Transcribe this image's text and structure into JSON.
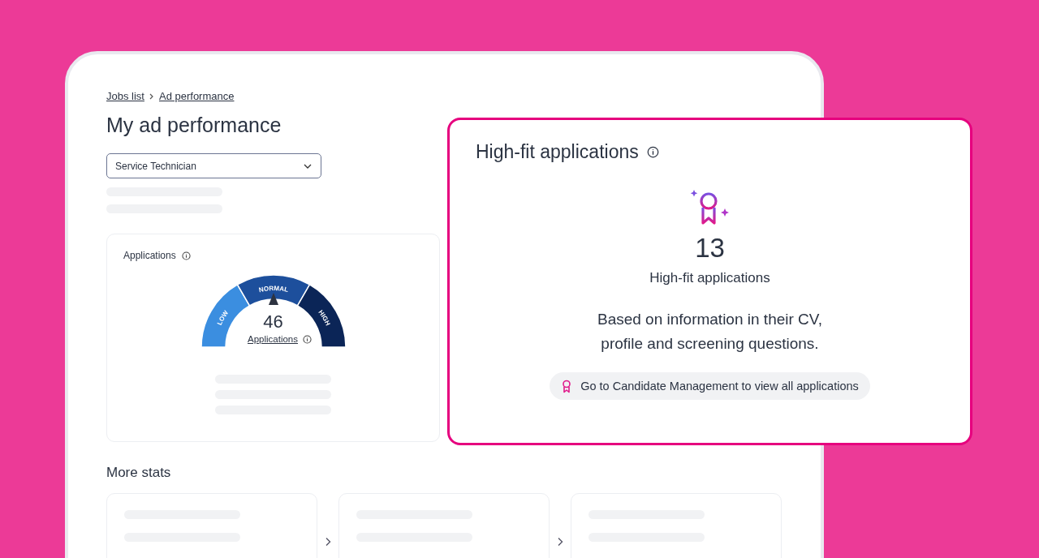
{
  "breadcrumb": [
    {
      "label": "Jobs list"
    },
    {
      "label": "Ad performance"
    }
  ],
  "page_title": "My ad performance",
  "job_select": {
    "value": "Service Technician"
  },
  "applications_card": {
    "title": "Applications",
    "gauge": {
      "segments": [
        {
          "label": "LOW",
          "color": "#3b8ee0"
        },
        {
          "label": "NORMAL",
          "color": "#1d4f9c"
        },
        {
          "label": "HIGH",
          "color": "#0b2557"
        }
      ]
    },
    "count": "46",
    "count_label": "Applications"
  },
  "more_stats": {
    "title": "More stats"
  },
  "high_fit_card": {
    "title": "High-fit applications",
    "count": "13",
    "count_label": "High-fit applications",
    "description_lines": [
      "Based on information in their CV,",
      "profile and screening questions."
    ],
    "link": "Go to Candidate Management to view all applications"
  }
}
